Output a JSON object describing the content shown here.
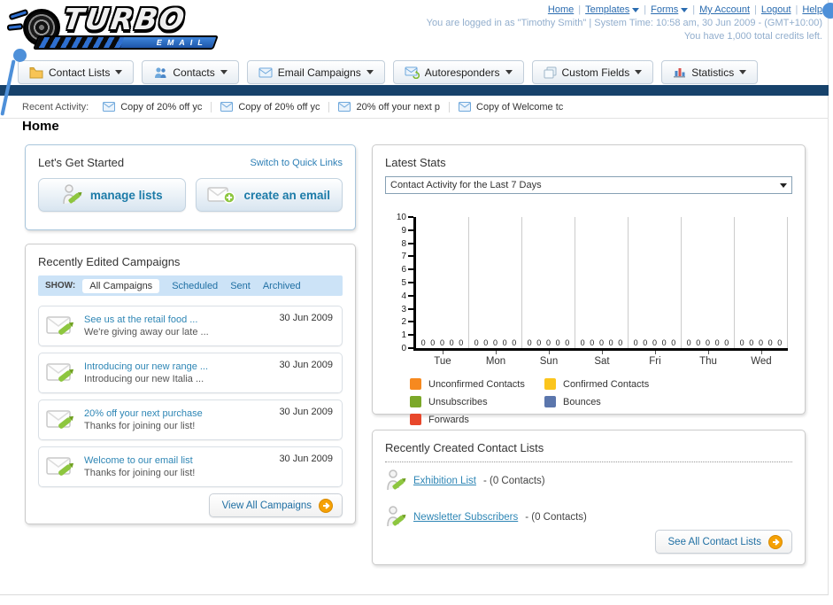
{
  "page": {
    "title": "Home"
  },
  "logo": {
    "line1": "TURBO",
    "line2": "EMAIL"
  },
  "header": {
    "links": [
      {
        "label": "Home",
        "dropdown": false
      },
      {
        "label": "Templates",
        "dropdown": true
      },
      {
        "label": "Forms",
        "dropdown": true
      },
      {
        "label": "My Account",
        "dropdown": false
      },
      {
        "label": "Logout",
        "dropdown": false
      },
      {
        "label": "Help",
        "dropdown": false
      }
    ],
    "status_line1": "You are logged in as \"Timothy Smith\" | System Time: 10:58 am, 30 Jun 2009 - (GMT+10:00)",
    "status_line2": "You have 1,000 total credits left."
  },
  "nav": {
    "tabs": [
      {
        "label": "Contact Lists",
        "icon": "folder-icon"
      },
      {
        "label": "Contacts",
        "icon": "contacts-icon"
      },
      {
        "label": "Email Campaigns",
        "icon": "envelope-icon"
      },
      {
        "label": "Autoresponders",
        "icon": "autoresponder-icon"
      },
      {
        "label": "Custom Fields",
        "icon": "custom-fields-icon"
      },
      {
        "label": "Statistics",
        "icon": "statistics-icon"
      }
    ]
  },
  "recent_activity": {
    "label": "Recent Activity:",
    "items": [
      "Copy of 20% off yc",
      "Copy of 20% off yc",
      "20% off your next p",
      "Copy of Welcome tc"
    ]
  },
  "getting_started": {
    "title": "Let's Get Started",
    "switch_link": "Switch to Quick Links",
    "buttons": [
      {
        "label": "manage lists"
      },
      {
        "label": "create an email"
      }
    ]
  },
  "campaigns": {
    "title": "Recently Edited Campaigns",
    "show_label": "SHOW:",
    "filters": [
      "All Campaigns",
      "Scheduled",
      "Sent",
      "Archived"
    ],
    "active_filter": "All Campaigns",
    "items": [
      {
        "title": "See us at the retail food ...",
        "subtitle": "We're giving away our late ...",
        "date": "30 Jun 2009"
      },
      {
        "title": "Introducing our new range ...",
        "subtitle": "Introducing our new Italia ...",
        "date": "30 Jun 2009"
      },
      {
        "title": "20% off your next purchase",
        "subtitle": "Thanks for joining our list!",
        "date": "30 Jun 2009"
      },
      {
        "title": "Welcome to our email list",
        "subtitle": "Thanks for joining our list!",
        "date": "30 Jun 2009"
      }
    ],
    "view_all_label": "View All Campaigns"
  },
  "stats": {
    "title": "Latest Stats",
    "dropdown_value": "Contact Activity for the Last 7 Days"
  },
  "chart_data": {
    "type": "bar",
    "title": "Contact Activity for the Last 7 Days",
    "categories": [
      "Tue",
      "Mon",
      "Sun",
      "Sat",
      "Fri",
      "Thu",
      "Wed"
    ],
    "series": [
      {
        "name": "Unconfirmed Contacts",
        "color": "#F6891F",
        "values": [
          0,
          0,
          0,
          0,
          0,
          0,
          0
        ]
      },
      {
        "name": "Confirmed Contacts",
        "color": "#FBC51D",
        "values": [
          0,
          0,
          0,
          0,
          0,
          0,
          0
        ]
      },
      {
        "name": "Unsubscribes",
        "color": "#7BA829",
        "values": [
          0,
          0,
          0,
          0,
          0,
          0,
          0
        ]
      },
      {
        "name": "Bounces",
        "color": "#5B76AC",
        "values": [
          0,
          0,
          0,
          0,
          0,
          0,
          0
        ]
      },
      {
        "name": "Forwards",
        "color": "#E8472B",
        "values": [
          0,
          0,
          0,
          0,
          0,
          0,
          0
        ]
      }
    ],
    "ylim": [
      0,
      10
    ],
    "yticks": [
      0,
      1,
      2,
      3,
      4,
      5,
      6,
      7,
      8,
      9,
      10
    ],
    "grid": "vertical-group-separators",
    "legend_position": "bottom",
    "show_value_labels": true
  },
  "contact_lists": {
    "title": "Recently Created Contact Lists",
    "items": [
      {
        "name": "Exhibition List",
        "detail": "- (0 Contacts)"
      },
      {
        "name": "Newsletter Subscribers",
        "detail": "- (0 Contacts)"
      }
    ],
    "see_all_label": "See All Contact Lists"
  }
}
